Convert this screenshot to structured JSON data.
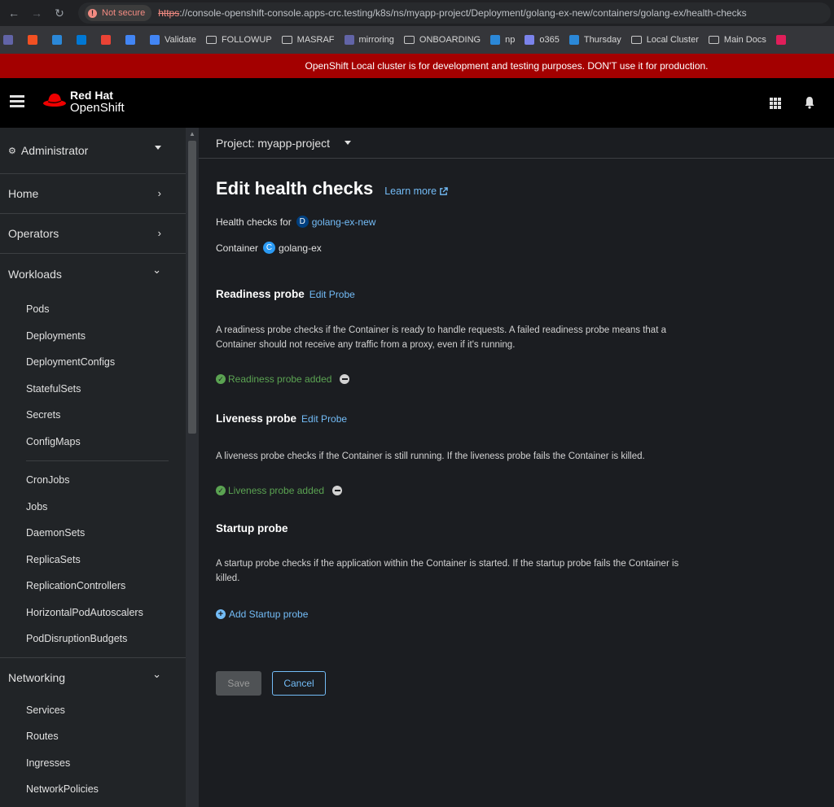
{
  "browser": {
    "not_secure": "Not secure",
    "url_scheme": "https",
    "url_rest": "://console-openshift-console.apps-crc.testing/k8s/ns/myapp-project/Deployment/golang-ex-new/containers/golang-ex/health-checks",
    "bookmarks": [
      {
        "label": "",
        "icon": "teams-icon",
        "color": "#6264a7"
      },
      {
        "label": "",
        "icon": "windows-icon",
        "color": "#f25022"
      },
      {
        "label": "",
        "icon": "app-icon",
        "color": "#2b88d8"
      },
      {
        "label": "",
        "icon": "outlook-icon",
        "color": "#0078d4"
      },
      {
        "label": "",
        "icon": "gmail-icon",
        "color": "#ea4335"
      },
      {
        "label": "",
        "icon": "calendar-icon",
        "color": "#4285f4"
      },
      {
        "label": "Validate",
        "icon": "diamond-icon",
        "color": "#4285f4"
      },
      {
        "label": "FOLLOWUP",
        "icon": "folder-icon",
        "color": ""
      },
      {
        "label": "MASRAF",
        "icon": "folder-icon",
        "color": ""
      },
      {
        "label": "mirroring",
        "icon": "teams-icon",
        "color": "#6264a7"
      },
      {
        "label": "ONBOARDING",
        "icon": "folder-icon",
        "color": ""
      },
      {
        "label": "np",
        "icon": "vscode-icon",
        "color": "#2b88d8"
      },
      {
        "label": "o365",
        "icon": "o365-icon",
        "color": "#7b83eb"
      },
      {
        "label": "Thursday",
        "icon": "cloud-icon",
        "color": "#2b88d8"
      },
      {
        "label": "Local Cluster",
        "icon": "folder-icon",
        "color": ""
      },
      {
        "label": "Main Docs",
        "icon": "folder-icon",
        "color": ""
      },
      {
        "label": "",
        "icon": "slack-icon",
        "color": "#e01e5a"
      }
    ]
  },
  "banner": {
    "text": "OpenShift Local cluster is for development and testing purposes. DON'T use it for production.",
    "color": "#a30000"
  },
  "masthead": {
    "brand_line1": "Red Hat",
    "brand_line2": "OpenShift"
  },
  "sidebar": {
    "perspective": "Administrator",
    "sections": [
      {
        "label": "Home",
        "chevron": "›"
      },
      {
        "label": "Operators",
        "chevron": "›"
      },
      {
        "label": "Workloads",
        "chevron": "⌄"
      }
    ],
    "workloads_items_a": [
      "Pods",
      "Deployments",
      "DeploymentConfigs",
      "StatefulSets",
      "Secrets",
      "ConfigMaps"
    ],
    "workloads_items_b": [
      "CronJobs",
      "Jobs",
      "DaemonSets",
      "ReplicaSets",
      "ReplicationControllers",
      "HorizontalPodAutoscalers",
      "PodDisruptionBudgets"
    ],
    "networking": {
      "label": "Networking",
      "chevron": "⌄"
    },
    "networking_items": [
      "Services",
      "Routes",
      "Ingresses",
      "NetworkPolicies"
    ]
  },
  "project": {
    "label": "Project: myapp-project"
  },
  "page": {
    "title": "Edit health checks",
    "learn_more": "Learn more",
    "health_checks_for_label": "Health checks for",
    "deployment_badge": "D",
    "deployment_name": "golang-ex-new",
    "container_label": "Container",
    "container_badge": "C",
    "container_name": "golang-ex"
  },
  "probes": {
    "readiness": {
      "title": "Readiness probe",
      "edit": "Edit Probe",
      "desc": "A readiness probe checks if the Container is ready to handle requests. A failed readiness probe means that a Container should not receive any traffic from a proxy, even if it's running.",
      "status": "Readiness probe added"
    },
    "liveness": {
      "title": "Liveness probe",
      "edit": "Edit Probe",
      "desc": "A liveness probe checks if the Container is still running. If the liveness probe fails the Container is killed.",
      "status": "Liveness probe added"
    },
    "startup": {
      "title": "Startup probe",
      "desc": "A startup probe checks if the application within the Container is started. If the startup probe fails the Container is killed.",
      "add": "Add Startup probe"
    }
  },
  "actions": {
    "save": "Save",
    "cancel": "Cancel"
  },
  "colors": {
    "link": "#73bcf7",
    "success": "#5ba352",
    "sidebar_bg": "#212427",
    "main_bg": "#1b1d21"
  }
}
